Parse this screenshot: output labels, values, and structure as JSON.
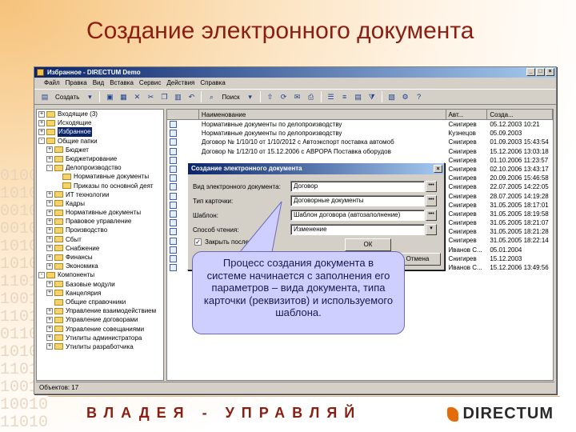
{
  "slide": {
    "title": "Создание электронного документа",
    "footer_motto": "ВЛАДЕЯ - УПРАВЛЯЙ",
    "footer_logo": "DIRECTUM",
    "binary": "0100110101001010010110100101001101010010110100110010100110101001010010110100101001101010010110100110010100110101001010010110100101"
  },
  "window": {
    "title": "Избранное - DIRECTUM Demo",
    "menu": [
      "Файл",
      "Правка",
      "Вид",
      "Вставка",
      "Сервис",
      "Действия",
      "Справка"
    ],
    "toolbar": {
      "create_label": "Создать",
      "search_label": "Поиск"
    },
    "status": "Объектов: 17"
  },
  "tree": [
    {
      "label": "Входящие (3)",
      "exp": "+"
    },
    {
      "label": "Исходящие",
      "exp": "+"
    },
    {
      "label": "Избранное",
      "exp": "+",
      "selected": true
    },
    {
      "label": "Общие папки",
      "exp": "-"
    },
    {
      "label": "Бюджет",
      "exp": "+",
      "indent": 1
    },
    {
      "label": "Бюджетирование",
      "exp": "+",
      "indent": 1
    },
    {
      "label": "Делопроизводство",
      "exp": "-",
      "indent": 1
    },
    {
      "label": "Нормативные документы",
      "exp": "",
      "indent": 2
    },
    {
      "label": "Приказы по основной деят",
      "exp": "",
      "indent": 2
    },
    {
      "label": "ИТ технологии",
      "exp": "+",
      "indent": 1
    },
    {
      "label": "Кадры",
      "exp": "+",
      "indent": 1
    },
    {
      "label": "Нормативные документы",
      "exp": "+",
      "indent": 1
    },
    {
      "label": "Правовое управление",
      "exp": "+",
      "indent": 1
    },
    {
      "label": "Производство",
      "exp": "+",
      "indent": 1
    },
    {
      "label": "Сбыт",
      "exp": "+",
      "indent": 1
    },
    {
      "label": "Снабжение",
      "exp": "+",
      "indent": 1
    },
    {
      "label": "Финансы",
      "exp": "+",
      "indent": 1
    },
    {
      "label": "Экономика",
      "exp": "+",
      "indent": 1
    },
    {
      "label": "Компоненты",
      "exp": "-"
    },
    {
      "label": "Базовые модули",
      "exp": "+",
      "indent": 1
    },
    {
      "label": "Канцелярия",
      "exp": "+",
      "indent": 1
    },
    {
      "label": "Общие справочники",
      "exp": "",
      "indent": 1
    },
    {
      "label": "Управление взаимодействием",
      "exp": "+",
      "indent": 1
    },
    {
      "label": "Управление договорами",
      "exp": "+",
      "indent": 1
    },
    {
      "label": "Управление совещаниями",
      "exp": "+",
      "indent": 1
    },
    {
      "label": "Утилиты администратора",
      "exp": "+",
      "indent": 1
    },
    {
      "label": "Утилиты разработчика",
      "exp": "+",
      "indent": 1
    }
  ],
  "list": {
    "headers": [
      "",
      "Наименование",
      "Авт...",
      "Созда..."
    ],
    "rows": [
      {
        "name": "Нормативные документы по делопроизводству",
        "author": "Снигирев",
        "date": "05.12.2003 10:21"
      },
      {
        "name": "Нормативные документы по делопроизводству",
        "author": "Кузнецов",
        "date": "05.09.2003"
      },
      {
        "name": "Договор № 1/10/10 от 1/10/2012 с Автоэкспорт поставка автомоб",
        "author": "Снигирев",
        "date": "01.09.2003 15:43:54"
      },
      {
        "name": "Договор № 1/12/10 от 15.12.2006 с АВРОРА Поставка оборудов",
        "author": "Снигирев",
        "date": "15.12.2006 13:03:18"
      },
      {
        "name": "",
        "author": "Снигирев",
        "date": "01.10.2006 11:23:57"
      },
      {
        "name": "",
        "author": "Снигирев",
        "date": "02.10.2006 13:43:17"
      },
      {
        "name": "",
        "author": "Снигирев",
        "date": "20.09.2006 15:46:58"
      },
      {
        "name": "",
        "author": "Снигирев",
        "date": "22.07.2005 14:22:05"
      },
      {
        "name": "",
        "author": "Снигирев",
        "date": "28.07.2005 14:19:28"
      },
      {
        "name": "",
        "author": "Снигирев",
        "date": "31.05.2005 18:17:01"
      },
      {
        "name": "",
        "author": "Снигирев",
        "date": "31.05.2005 18:19:58"
      },
      {
        "name": "",
        "author": "Снигирев",
        "date": "31.05.2005 18:21:07"
      },
      {
        "name": "",
        "author": "Снигирев",
        "date": "31.05.2005 18:21:28"
      },
      {
        "name": "",
        "author": "Снигирев",
        "date": "31.05.2005 18:22:14"
      },
      {
        "name": "Нормативные документы по делопроизводству",
        "author": "Иванов С...",
        "date": "05.01.2004"
      },
      {
        "name": "Договор поставки",
        "author": "Снигирев",
        "date": "15.12.2003"
      },
      {
        "name": "Договор № 12/12/10 от 15.12.2006 с АВРОРА поставка плате...",
        "author": "Иванов С...",
        "date": "15.12.2006 13:49:56"
      }
    ]
  },
  "dialog": {
    "title": "Создание электронного документа",
    "fields": [
      {
        "label": "Вид электронного документа:",
        "value": "Договор"
      },
      {
        "label": "Тип карточки:",
        "value": "Договорные документы"
      },
      {
        "label": "Шаблон:",
        "value": "Шаблон договора (автозаполнение)"
      },
      {
        "label": "Способ чтения:",
        "value": "Изменение"
      }
    ],
    "checkbox_label": "Закрыть после",
    "ok_label": "ОК",
    "cancel_label": "Отмена"
  },
  "callout": {
    "text": "Процесс создания документа в системе начинается с заполнения его параметров – вида документа, типа карточки (реквизитов) и используемого шаблона."
  },
  "colors": {
    "title": "#8a1e12",
    "accent": "#e36c0a",
    "callout_bg": "#cfcfff",
    "titlebar": "#0a246a"
  }
}
